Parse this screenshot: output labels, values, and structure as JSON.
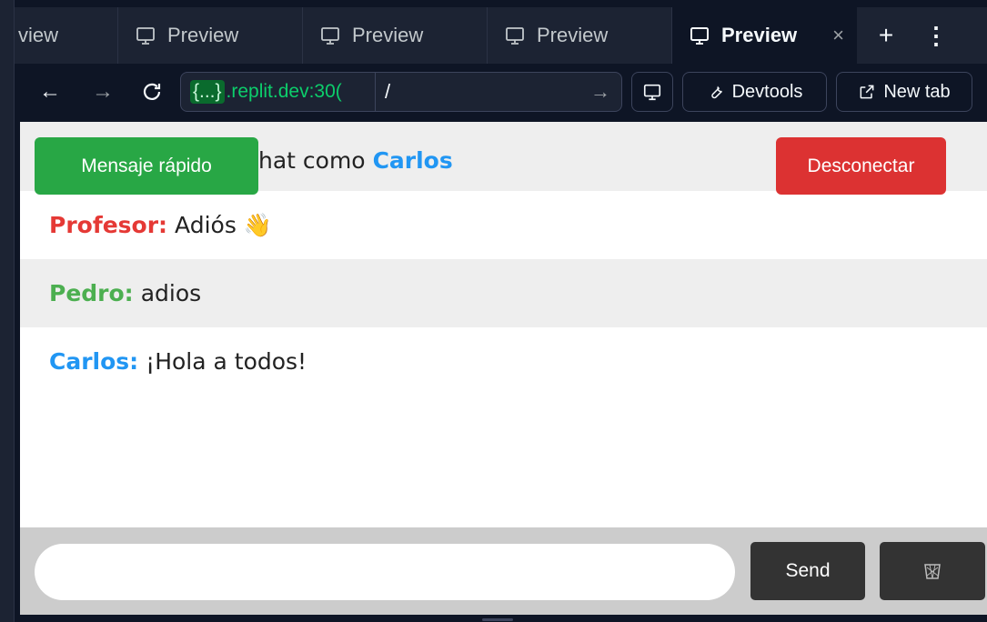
{
  "browser": {
    "tabs": [
      {
        "label": "view"
      },
      {
        "label": "Preview"
      },
      {
        "label": "Preview"
      },
      {
        "label": "Preview"
      },
      {
        "label": "Preview",
        "active": true
      }
    ],
    "close_symbol": "×",
    "new_tab_symbol": "+",
    "more_symbol": "⋮",
    "nav": {
      "back_symbol": "←",
      "forward_symbol": "→",
      "reload_symbol": "C",
      "url_brace": "{...}",
      "url_host": ".replit.dev:30(",
      "url_path": "/",
      "url_go_symbol": "→",
      "devtools_label": "Devtools",
      "new_tab_label": "New tab"
    }
  },
  "chat": {
    "header": {
      "title_prefix": "hat como",
      "username": "Carlos",
      "quick_message_label": "Mensaje rápido",
      "disconnect_label": "Desconectar"
    },
    "messages": [
      {
        "sender": "Profesor:",
        "text": "Adiós 👋",
        "color": "#e53935"
      },
      {
        "sender": "Pedro:",
        "text": "adios",
        "color": "#4caf50"
      },
      {
        "sender": "Carlos:",
        "text": "¡Hola a todos!",
        "color": "#2196f3"
      }
    ],
    "composer": {
      "input_value": "",
      "send_label": "Send",
      "clear_icon": "wastebasket-icon"
    }
  },
  "colors": {
    "quick_button": "#28a745",
    "disconnect_button": "#dc3232",
    "username_accent": "#2196f3"
  }
}
